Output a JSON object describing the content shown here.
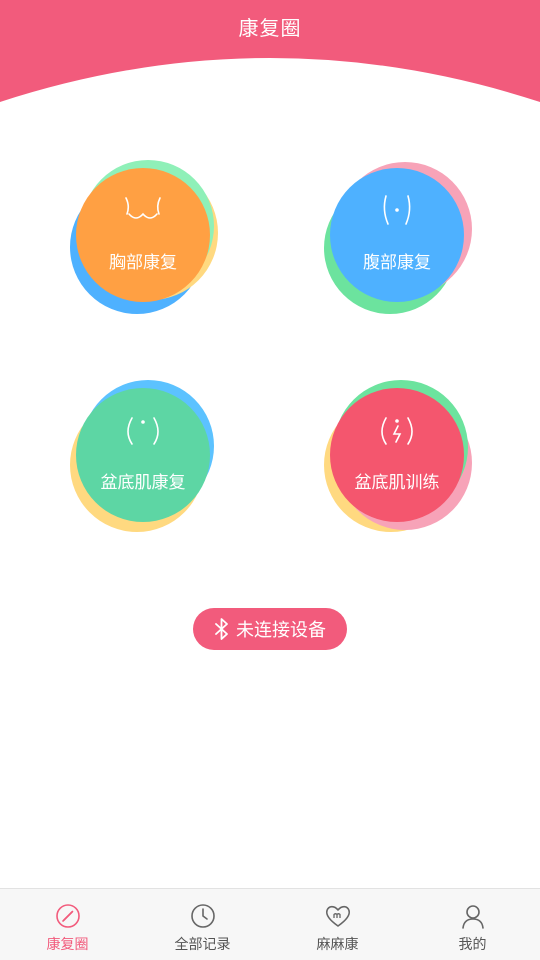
{
  "header": {
    "title": "康复圈"
  },
  "colors": {
    "brand": "#f25b7c",
    "orange": "#ffa043",
    "blue": "#4eb1ff",
    "green": "#5dd6a4",
    "red": "#f4566e"
  },
  "tiles": [
    {
      "label": "胸部康复",
      "icon": "chest-icon"
    },
    {
      "label": "腹部康复",
      "icon": "abdomen-icon"
    },
    {
      "label": "盆底肌康复",
      "icon": "pelvic-icon"
    },
    {
      "label": "盆底肌训练",
      "icon": "pelvic-training-icon"
    }
  ],
  "device": {
    "label": "未连接设备",
    "icon": "bluetooth-icon"
  },
  "tabs": [
    {
      "label": "康复圈",
      "icon": "compass-icon",
      "active": true
    },
    {
      "label": "全部记录",
      "icon": "clock-icon",
      "active": false
    },
    {
      "label": "麻麻康",
      "icon": "heart-icon",
      "active": false
    },
    {
      "label": "我的",
      "icon": "person-icon",
      "active": false
    }
  ]
}
